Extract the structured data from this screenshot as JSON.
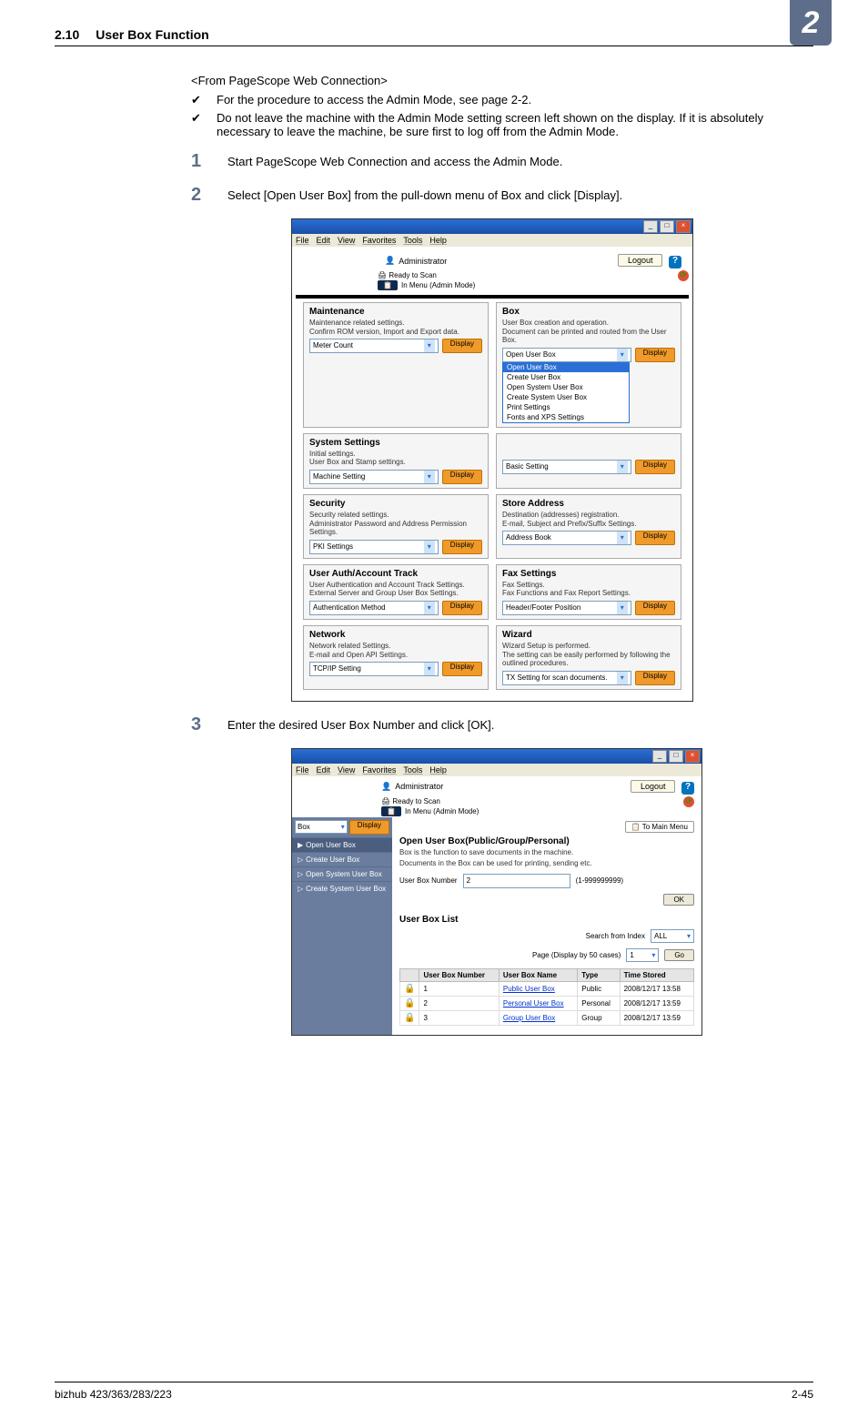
{
  "header": {
    "chapter_no": "2.10",
    "chapter_title": "User Box Function",
    "chapter_badge": "2"
  },
  "intro_heading": "<From PageScope Web Connection>",
  "bullets": [
    "For the procedure to access the Admin Mode, see page 2-2.",
    "Do not leave the machine with the Admin Mode setting screen left shown on the display. If it is absolutely necessary to leave the machine, be sure first to log off from the Admin Mode."
  ],
  "steps": {
    "s1": {
      "num": "1",
      "text": "Start PageScope Web Connection and access the Admin Mode."
    },
    "s2": {
      "num": "2",
      "text": "Select [Open User Box] from the pull-down menu of Box and click [Display]."
    },
    "s3": {
      "num": "3",
      "text": "Enter the desired User Box Number and click [OK]."
    }
  },
  "ss_common": {
    "menu": {
      "file": "File",
      "edit": "Edit",
      "view": "View",
      "favorites": "Favorites",
      "tools": "Tools",
      "help": "Help"
    },
    "administrator": "Administrator",
    "ready": "Ready to Scan",
    "in_menu": "In Menu (Admin Mode)",
    "logout": "Logout",
    "help": "?",
    "display": "Display"
  },
  "ss1": {
    "cards": {
      "maintenance": {
        "title": "Maintenance",
        "desc": "Maintenance related settings.\nConfirm ROM version, Import and Export data.",
        "select": "Meter Count"
      },
      "box": {
        "title": "Box",
        "desc": "User Box creation and operation.\nDocument can be printed and routed from the User Box.",
        "select": "Open User Box",
        "options": [
          "Open User Box",
          "Create User Box",
          "Open System User Box",
          "Create System User Box",
          "Print Settings",
          "Fonts and XPS Settings"
        ]
      },
      "system": {
        "title": "System Settings",
        "desc": "Initial settings.\nUser Box and Stamp settings.",
        "select": "Machine Setting"
      },
      "basic": {
        "select": "Basic Setting"
      },
      "security": {
        "title": "Security",
        "desc": "Security related settings.\nAdministrator Password and Address Permission Settings.",
        "select": "PKI Settings"
      },
      "store": {
        "title": "Store Address",
        "desc": "Destination (addresses) registration.\nE-mail, Subject and Prefix/Suffix Settings.",
        "select": "Address Book"
      },
      "auth": {
        "title": "User Auth/Account Track",
        "desc": "User Authentication and Account Track Settings.\nExternal Server and Group User Box Settings.",
        "select": "Authentication Method"
      },
      "fax": {
        "title": "Fax Settings",
        "desc": "Fax Settings.\nFax Functions and Fax Report Settings.",
        "select": "Header/Footer Position"
      },
      "network": {
        "title": "Network",
        "desc": "Network related Settings.\nE-mail and Open API Settings.",
        "select": "TCP/IP Setting"
      },
      "wizard": {
        "title": "Wizard",
        "desc": "Wizard Setup is performed.\nThe setting can be easily performed by following the outlined procedures.",
        "select": "TX Setting for scan documents."
      }
    }
  },
  "ss2": {
    "sidebar": {
      "category": "Box",
      "items": [
        "Open User Box",
        "Create User Box",
        "Open System User Box",
        "Create System User Box"
      ]
    },
    "to_main": "To Main Menu",
    "pane_title": "Open User Box(Public/Group/Personal)",
    "pane_desc1": "Box is the function to save documents in the machine.",
    "pane_desc2": "Documents in the Box can be used for printing, sending etc.",
    "field_label": "User Box Number",
    "field_value": "2",
    "field_range": "(1-999999999)",
    "ok": "OK",
    "list_title": "User Box List",
    "search_label": "Search from Index",
    "search_sel": "ALL",
    "page_label": "Page (Display by 50 cases)",
    "page_sel": "1",
    "go": "Go",
    "columns": {
      "num": "User Box Number",
      "name": "User Box Name",
      "type": "Type",
      "time": "Time Stored"
    },
    "rows": [
      {
        "num": "1",
        "name": "Public User Box",
        "type": "Public",
        "time": "2008/12/17 13:58"
      },
      {
        "num": "2",
        "name": "Personal User Box",
        "type": "Personal",
        "time": "2008/12/17 13:59"
      },
      {
        "num": "3",
        "name": "Group User Box",
        "type": "Group",
        "time": "2008/12/17 13:59"
      }
    ]
  },
  "footer": {
    "left": "bizhub 423/363/283/223",
    "right": "2-45"
  }
}
